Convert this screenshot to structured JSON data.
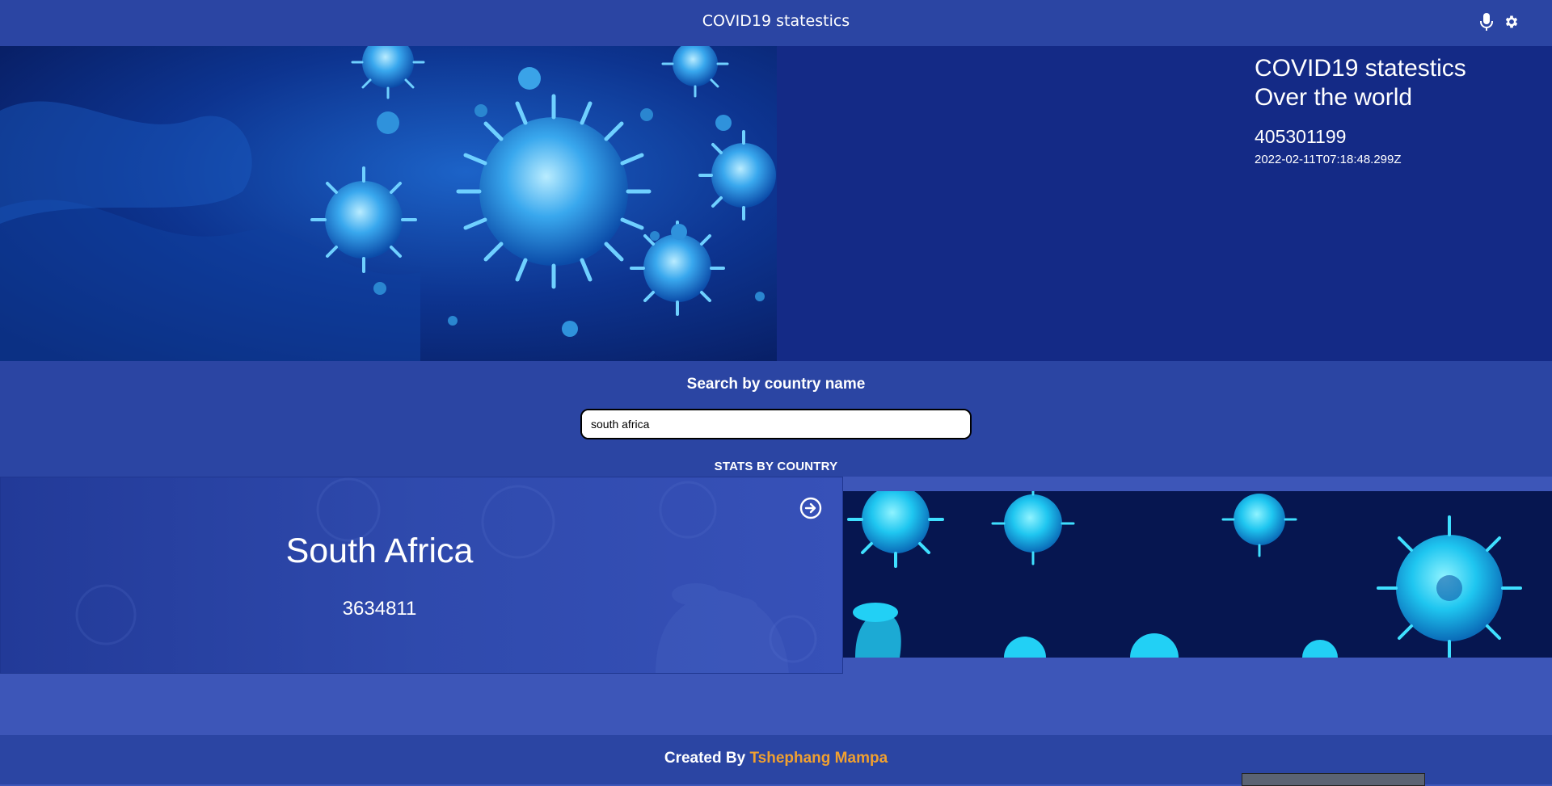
{
  "header": {
    "title": "COVID19 statestics",
    "icons": [
      "microphone-icon",
      "gear-icon"
    ]
  },
  "hero": {
    "heading_line1": "COVID19 statestics",
    "heading_line2": "Over the world",
    "total_cases": "405301199",
    "updated_at": "2022-02-11T07:18:48.299Z"
  },
  "search": {
    "label": "Search by country name",
    "value": "south africa"
  },
  "stats": {
    "heading": "STATS BY COUNTRY",
    "card": {
      "country": "South Africa",
      "cases": "3634811",
      "action_icon": "arrow-right-circle-icon"
    }
  },
  "footer": {
    "prefix": "Created By",
    "author": "Tshephang Mampa"
  },
  "colors": {
    "page_bg": "#3d56b8",
    "bar_bg": "#2b45a3",
    "hero_bg": "#142a86",
    "author_accent": "#f0a030"
  }
}
